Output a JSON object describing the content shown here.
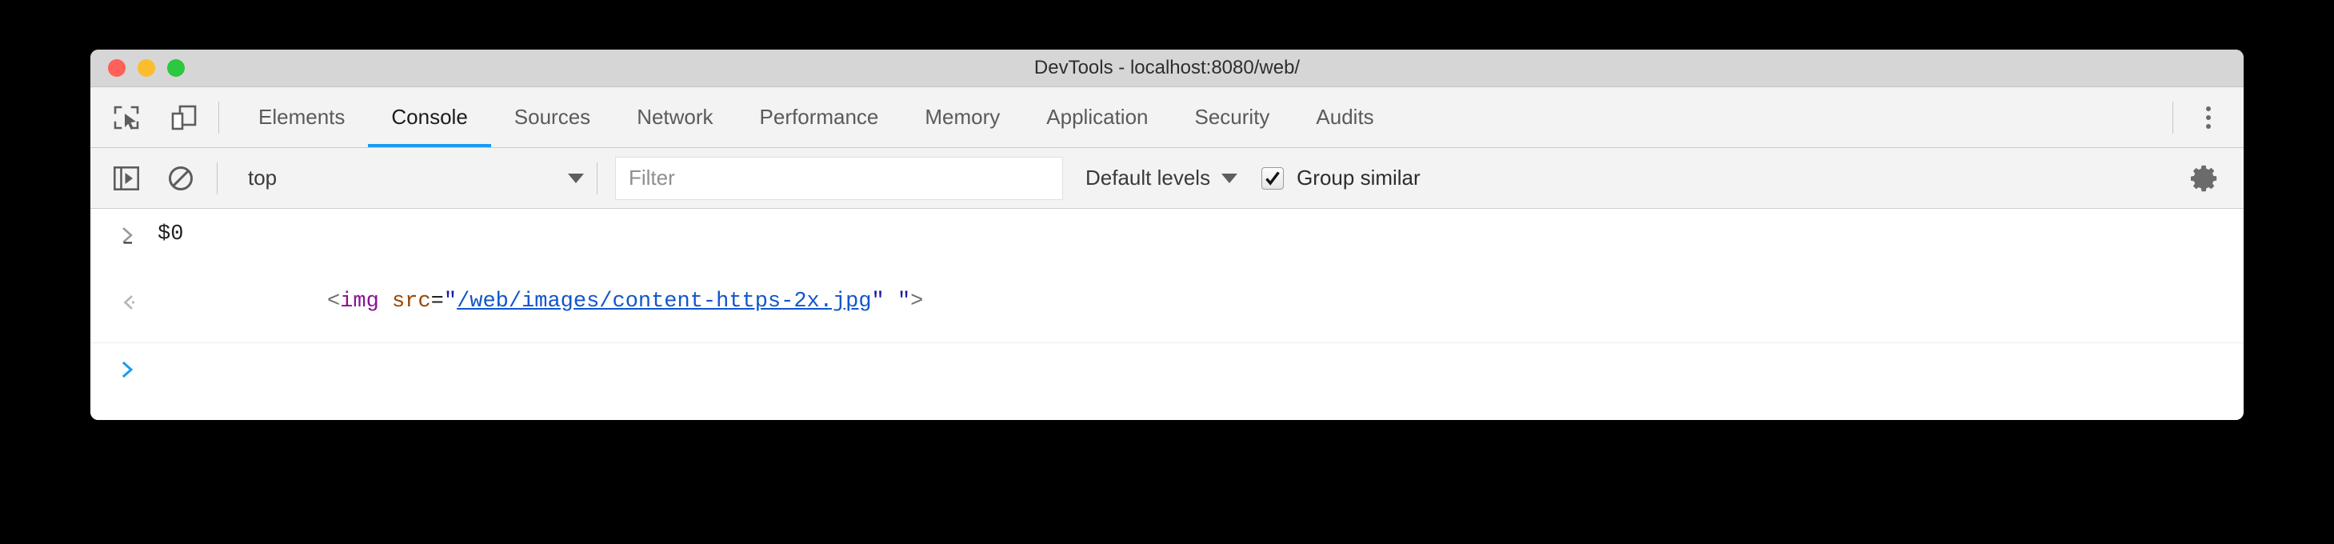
{
  "window": {
    "title": "DevTools - localhost:8080/web/",
    "traffic_lights": [
      {
        "name": "close",
        "color": "#ff6058"
      },
      {
        "name": "minimize",
        "color": "#fbbd2e"
      },
      {
        "name": "maximize",
        "color": "#2bc840"
      }
    ]
  },
  "toolbar_icons": {
    "inspect": "inspect-element-icon",
    "device": "device-toolbar-icon",
    "kebab": "more-options-icon"
  },
  "tabs": [
    {
      "label": "Elements",
      "active": false
    },
    {
      "label": "Console",
      "active": true
    },
    {
      "label": "Sources",
      "active": false
    },
    {
      "label": "Network",
      "active": false
    },
    {
      "label": "Performance",
      "active": false
    },
    {
      "label": "Memory",
      "active": false
    },
    {
      "label": "Application",
      "active": false
    },
    {
      "label": "Security",
      "active": false
    },
    {
      "label": "Audits",
      "active": false
    }
  ],
  "console_toolbar": {
    "sidebar_toggle_icon": "show-console-sidebar-icon",
    "clear_console_icon": "clear-console-icon",
    "context": "top",
    "filter_placeholder": "Filter",
    "filter_value": "",
    "levels_label": "Default levels",
    "group_similar_label": "Group similar",
    "group_similar_checked": true,
    "settings_icon": "gear-icon"
  },
  "console": {
    "rows": [
      {
        "type": "input",
        "prompt": "›",
        "text": "$0"
      },
      {
        "type": "result",
        "prompt": "‹",
        "tokens": [
          {
            "cls": "tok-bracket",
            "t": "<"
          },
          {
            "cls": "tok-tag",
            "t": "img"
          },
          {
            "cls": "tok-plain",
            "t": " "
          },
          {
            "cls": "tok-attr",
            "t": "src"
          },
          {
            "cls": "tok-eq",
            "t": "="
          },
          {
            "cls": "tok-quote",
            "t": "\""
          },
          {
            "cls": "tok-link",
            "t": "/web/images/content-https-2x.jpg"
          },
          {
            "cls": "tok-quote",
            "t": "\""
          },
          {
            "cls": "tok-plain",
            "t": " "
          },
          {
            "cls": "tok-quote",
            "t": "\""
          },
          {
            "cls": "tok-bracket",
            "t": ">"
          }
        ]
      },
      {
        "type": "prompt",
        "prompt": "›",
        "text": ""
      }
    ]
  },
  "colors": {
    "accent": "#1a9af2",
    "titlebar": "#d6d6d6",
    "chrome": "#f3f3f3",
    "body": "#ffffff"
  }
}
